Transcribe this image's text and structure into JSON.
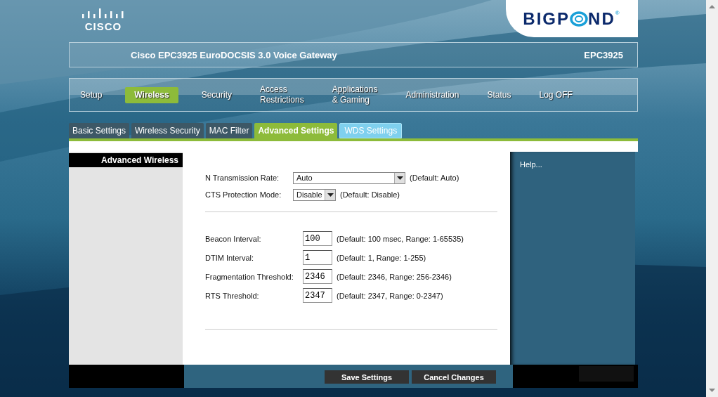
{
  "header": {
    "cisco_logo": "CISCO",
    "brand_logo": {
      "before": "BIGP",
      "after": "ND",
      "mark": "®"
    }
  },
  "title_bar": {
    "title": "Cisco EPC3925 EuroDOCSIS 3.0 Voice Gateway",
    "model": "EPC3925"
  },
  "nav": [
    {
      "label": "Setup",
      "selected": false
    },
    {
      "label": "Wireless",
      "selected": true
    },
    {
      "label": "Security",
      "selected": false
    },
    {
      "label": "Access\nRestrictions",
      "selected": false
    },
    {
      "label": "Applications\n& Gaming",
      "selected": false
    },
    {
      "label": "Administration",
      "selected": false
    },
    {
      "label": "Status",
      "selected": false
    },
    {
      "label": "Log OFF",
      "selected": false
    }
  ],
  "tabs": [
    {
      "label": "Basic Settings",
      "selected": false,
      "kind": "dark"
    },
    {
      "label": "Wireless Security",
      "selected": false,
      "kind": "dark"
    },
    {
      "label": "MAC Filter",
      "selected": false,
      "kind": "dark"
    },
    {
      "label": "Advanced Settings",
      "selected": true,
      "kind": "dark"
    },
    {
      "label": "WDS Settings",
      "selected": false,
      "kind": "light"
    }
  ],
  "section_title": "Advanced Wireless",
  "selects": [
    {
      "label": "N Transmission Rate:",
      "value": "Auto",
      "hint": "(Default: Auto)",
      "kind": "wide"
    },
    {
      "label": "CTS Protection Mode:",
      "value": "Disable",
      "hint": "(Default: Disable)",
      "kind": "narrow"
    }
  ],
  "inputs": [
    {
      "label": "Beacon Interval:",
      "value": "100",
      "hint": "(Default: 100 msec, Range: 1-65535)"
    },
    {
      "label": "DTIM Interval:",
      "value": "1",
      "hint": "(Default: 1, Range: 1-255)"
    },
    {
      "label": "Fragmentation Threshold:",
      "value": "2346",
      "hint": "(Default: 2346, Range: 256-2346)"
    },
    {
      "label": "RTS Threshold:",
      "value": "2347",
      "hint": "(Default: 2347, Range: 0-2347)"
    }
  ],
  "help_link": "Help...",
  "buttons": [
    "Save Settings",
    "Cancel Changes"
  ]
}
